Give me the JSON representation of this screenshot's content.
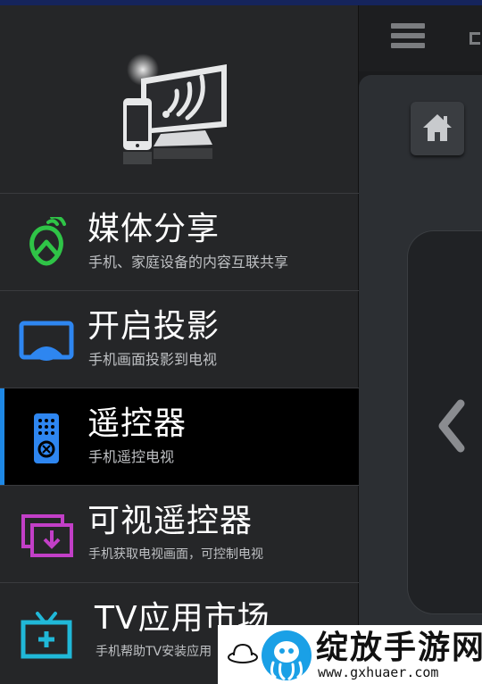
{
  "app": {
    "logo": "screen-mirroring-logo",
    "colors": {
      "accent": "#1e88e5",
      "background": "#252628",
      "active_background": "#000000"
    }
  },
  "menu": {
    "items": [
      {
        "title": "媒体分享",
        "subtitle": "手机、家庭设备的内容互联共享",
        "icon": "media-share-icon",
        "color": "#2fc447"
      },
      {
        "title": "开启投影",
        "subtitle": "手机画面投影到电视",
        "icon": "screen-cast-icon",
        "color": "#2e86f0"
      },
      {
        "title": "遥控器",
        "subtitle": "手机遥控电视",
        "icon": "remote-control-icon",
        "color": "#2e86f0",
        "active": true
      },
      {
        "title": "可视遥控器",
        "subtitle": "手机获取电视画面，可控制电视",
        "icon": "visual-remote-icon",
        "color": "#c23fc7"
      },
      {
        "title": "TV应用市场",
        "subtitle": "手机帮助TV安装应用",
        "icon": "tv-app-market-icon",
        "color": "#20b8d8"
      }
    ]
  },
  "remote": {
    "menu_icon": "hamburger-icon",
    "home_icon": "home-icon",
    "left_icon": "chevron-left-icon"
  },
  "watermark": {
    "text": "绽放手游网",
    "url": "www.gxhuaer.com"
  }
}
